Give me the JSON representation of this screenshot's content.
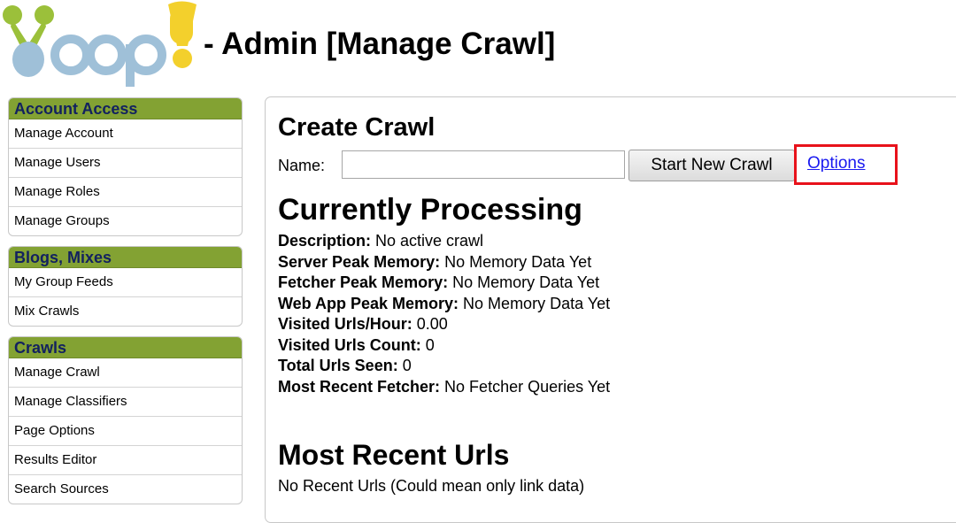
{
  "header": {
    "title": "- Admin [Manage Crawl]"
  },
  "logo": {
    "name": "Yioop logo",
    "text": "Yioop!"
  },
  "sidebar": {
    "sections": [
      {
        "title": "Account Access",
        "items": [
          "Manage Account",
          "Manage Users",
          "Manage Roles",
          "Manage Groups"
        ]
      },
      {
        "title": "Blogs, Mixes",
        "items": [
          "My Group Feeds",
          "Mix Crawls"
        ]
      },
      {
        "title": "Crawls",
        "items": [
          "Manage Crawl",
          "Manage Classifiers",
          "Page Options",
          "Results Editor",
          "Search Sources"
        ]
      }
    ]
  },
  "create_crawl": {
    "heading": "Create Crawl",
    "name_label": "Name:",
    "name_value": "",
    "start_button": "Start New Crawl",
    "options_link": "Options"
  },
  "processing": {
    "heading": "Currently Processing",
    "rows": [
      {
        "label": "Description:",
        "value": " No active crawl"
      },
      {
        "label": "Server Peak Memory:",
        "value": " No Memory Data Yet"
      },
      {
        "label": "Fetcher Peak Memory:",
        "value": " No Memory Data Yet"
      },
      {
        "label": "Web App Peak Memory:",
        "value": " No Memory Data Yet"
      },
      {
        "label": "Visited Urls/Hour:",
        "value": " 0.00"
      },
      {
        "label": "Visited Urls Count:",
        "value": " 0"
      },
      {
        "label": "Total Urls Seen:",
        "value": " 0"
      },
      {
        "label": "Most Recent Fetcher:",
        "value": " No Fetcher Queries Yet"
      }
    ]
  },
  "recent_urls": {
    "heading": "Most Recent Urls",
    "text": "No Recent Urls (Could mean only link data)"
  },
  "colors": {
    "menu_header": "#83a233",
    "menu_header_text": "#12215f",
    "highlight_box": "#e8121b",
    "link": "#1a1af0",
    "logo_green": "#9bc03a",
    "logo_blue": "#9fc0d8",
    "logo_yellow": "#f3d02c"
  }
}
